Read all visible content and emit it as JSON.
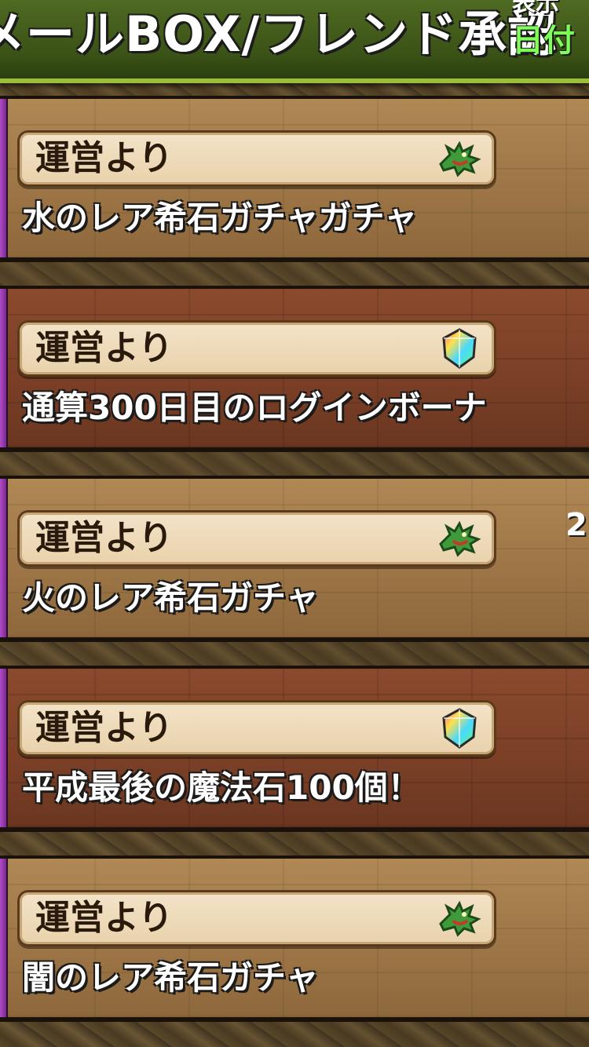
{
  "header": {
    "title": "メールBOX/フレンド承認",
    "sort_label": "表示",
    "sort_value": "日付"
  },
  "mails": [
    {
      "sender": "運営より",
      "subject": "水のレア希石ガチャガチャ",
      "icon": "dragon-icon",
      "side_count": ""
    },
    {
      "sender": "運営より",
      "subject": "通算300日目のログインボーナ",
      "icon": "magic-stone-icon",
      "side_count": ""
    },
    {
      "sender": "運営より",
      "subject": "火のレア希石ガチャ",
      "icon": "dragon-icon",
      "side_count": "2"
    },
    {
      "sender": "運営より",
      "subject": "平成最後の魔法石100個！",
      "icon": "magic-stone-icon",
      "side_count": ""
    },
    {
      "sender": "運営より",
      "subject": "闇のレア希石ガチャ",
      "icon": "dragon-icon",
      "side_count": ""
    }
  ],
  "colors": {
    "header_green": "#3a5216",
    "accent_green": "#7fff5a",
    "edge_purple": "#b04ac8"
  }
}
